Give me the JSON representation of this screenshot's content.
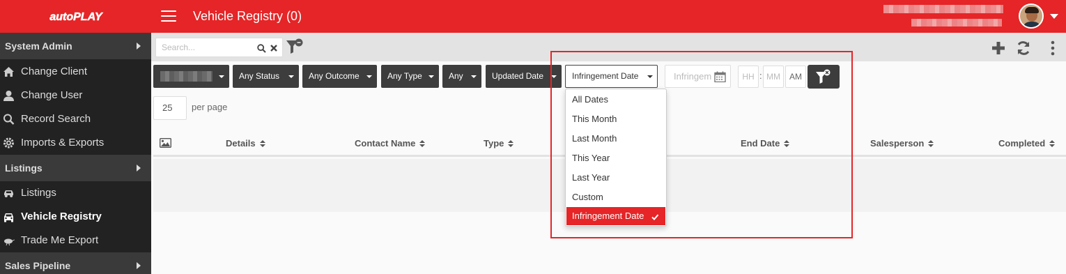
{
  "colors": {
    "brand": "#e52527",
    "sidebar": "#222222",
    "button": "#3d3d3d"
  },
  "header": {
    "logo_text": "autoPLAY",
    "title": "Vehicle Registry (0)"
  },
  "sidebar": {
    "sections": [
      {
        "label": "System Admin"
      },
      {
        "label": "Listings"
      },
      {
        "label": "Sales Pipeline"
      }
    ],
    "admin_items": [
      {
        "label": "Change Client",
        "icon": "home-icon"
      },
      {
        "label": "Change User",
        "icon": "user-icon"
      },
      {
        "label": "Record Search",
        "icon": "search-icon"
      },
      {
        "label": "Imports & Exports",
        "icon": "gear-icon"
      }
    ],
    "listing_items": [
      {
        "label": "Listings",
        "icon": "car-icon"
      },
      {
        "label": "Vehicle Registry",
        "icon": "car-front-icon"
      },
      {
        "label": "Trade Me Export",
        "icon": "kiwi-icon"
      }
    ]
  },
  "search": {
    "placeholder": "Search...",
    "value": ""
  },
  "filters": {
    "status": "Any Status",
    "outcome": "Any Outcome",
    "type": "Any Type",
    "any": "Any",
    "sort": "Updated Date",
    "date_field": "Infringement Date",
    "date_placeholder": "Infringem",
    "hour_placeholder": "HH",
    "minute_placeholder": "MM",
    "ampm": "AM",
    "time_separator": ":"
  },
  "pagination": {
    "per_page": "25",
    "per_page_label": "per page"
  },
  "table": {
    "columns": [
      "Details",
      "Contact Name",
      "Type",
      "End Date",
      "Salesperson",
      "Completed"
    ]
  },
  "date_menu": {
    "options": [
      "All Dates",
      "This Month",
      "Last Month",
      "This Year",
      "Last Year",
      "Custom",
      "Infringement Date"
    ],
    "selected": "Infringement Date"
  }
}
